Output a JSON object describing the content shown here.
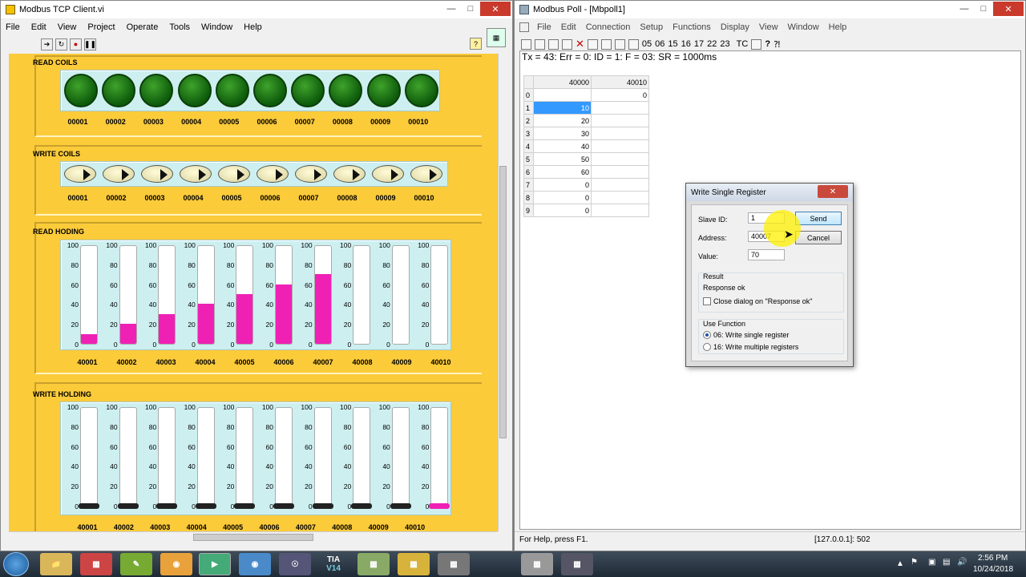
{
  "labview": {
    "title": "Modbus TCP Client.vi",
    "menu": [
      "File",
      "Edit",
      "View",
      "Project",
      "Operate",
      "Tools",
      "Window",
      "Help"
    ],
    "groups": {
      "read_coils": "READ COILS",
      "write_coils": "WRITE COILS",
      "read_holding": "READ HODING",
      "write_holding": "WRITE HOLDING"
    },
    "coil_labels": [
      "00001",
      "00002",
      "00003",
      "00004",
      "00005",
      "00006",
      "00007",
      "00008",
      "00009",
      "00010"
    ],
    "reg_labels": [
      "40001",
      "40002",
      "40003",
      "40004",
      "40005",
      "40006",
      "40007",
      "40008",
      "40009",
      "40010"
    ],
    "scale_ticks": [
      "100",
      "80",
      "60",
      "40",
      "20",
      "0"
    ],
    "read_holding_values": [
      10,
      20,
      30,
      40,
      50,
      60,
      70,
      0,
      0,
      0
    ],
    "write_holding_values": [
      0,
      0,
      0,
      0,
      0,
      0,
      0,
      0,
      0,
      0
    ],
    "led_color": "#1f7a15",
    "fill_color": "#ef21b5",
    "panel_color": "#fbcb3a"
  },
  "modbus_poll": {
    "title": "Modbus Poll - [Mbpoll1]",
    "menu": [
      "File",
      "Edit",
      "Connection",
      "Setup",
      "Functions",
      "Display",
      "View",
      "Window",
      "Help"
    ],
    "function_codes": [
      "05",
      "06",
      "15",
      "16",
      "17",
      "22",
      "23"
    ],
    "tc_label": "TC",
    "status_line": "Tx = 43: Err = 0: ID = 1: F = 03: SR = 1000ms",
    "columns": [
      "40000",
      "40010"
    ],
    "rows": [
      {
        "n": "0",
        "a": "",
        "b": "0"
      },
      {
        "n": "1",
        "a": "10",
        "b": ""
      },
      {
        "n": "2",
        "a": "20",
        "b": ""
      },
      {
        "n": "3",
        "a": "30",
        "b": ""
      },
      {
        "n": "4",
        "a": "40",
        "b": ""
      },
      {
        "n": "5",
        "a": "50",
        "b": ""
      },
      {
        "n": "6",
        "a": "60",
        "b": ""
      },
      {
        "n": "7",
        "a": "0",
        "b": ""
      },
      {
        "n": "8",
        "a": "0",
        "b": ""
      },
      {
        "n": "9",
        "a": "0",
        "b": ""
      }
    ],
    "help_status": "For Help, press F1.",
    "connection_status": "[127.0.0.1]: 502"
  },
  "dialog": {
    "title": "Write Single Register",
    "slave_id_label": "Slave ID:",
    "slave_id": "1",
    "address_label": "Address:",
    "address": "40007",
    "value_label": "Value:",
    "value": "70",
    "send": "Send",
    "cancel": "Cancel",
    "result_label": "Result",
    "result_text": "Response ok",
    "close_dialog": "Close dialog on \"Response ok\"",
    "use_function_label": "Use Function",
    "fn06": "06: Write single register",
    "fn16": "16: Write multiple registers"
  },
  "taskbar": {
    "tia": "TIA",
    "tia_ver": "V14",
    "time": "2:56 PM",
    "date": "10/24/2018"
  }
}
